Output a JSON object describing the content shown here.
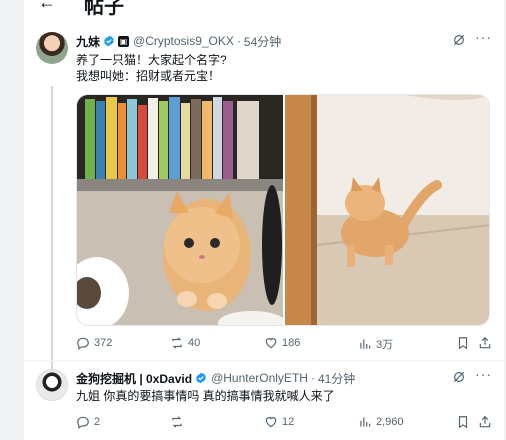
{
  "header": {
    "title": "帖子"
  },
  "post1": {
    "author_name": "九妹",
    "handle": "@Cryptosis9_OKX",
    "time": "54分钟",
    "text_line1": "养了一只猫！大家起个名字?",
    "text_line2": "我想叫她：招财或者元宝！",
    "stats": {
      "replies": "372",
      "reposts": "40",
      "likes": "186",
      "views": "3万"
    }
  },
  "post2": {
    "author_name": "金狗挖掘机 | 0xDavid",
    "handle": "@HunterOnlyETH",
    "time": "41分钟",
    "text": "九姐 你真的要搞事情吗 真的搞事情我就喊人来了",
    "stats": {
      "replies": "2",
      "reposts": "",
      "likes": "12",
      "views": "2,960"
    }
  },
  "colors": {
    "verified": "#1d9bf0",
    "muted": "#536471",
    "divider": "#eff3f4"
  }
}
